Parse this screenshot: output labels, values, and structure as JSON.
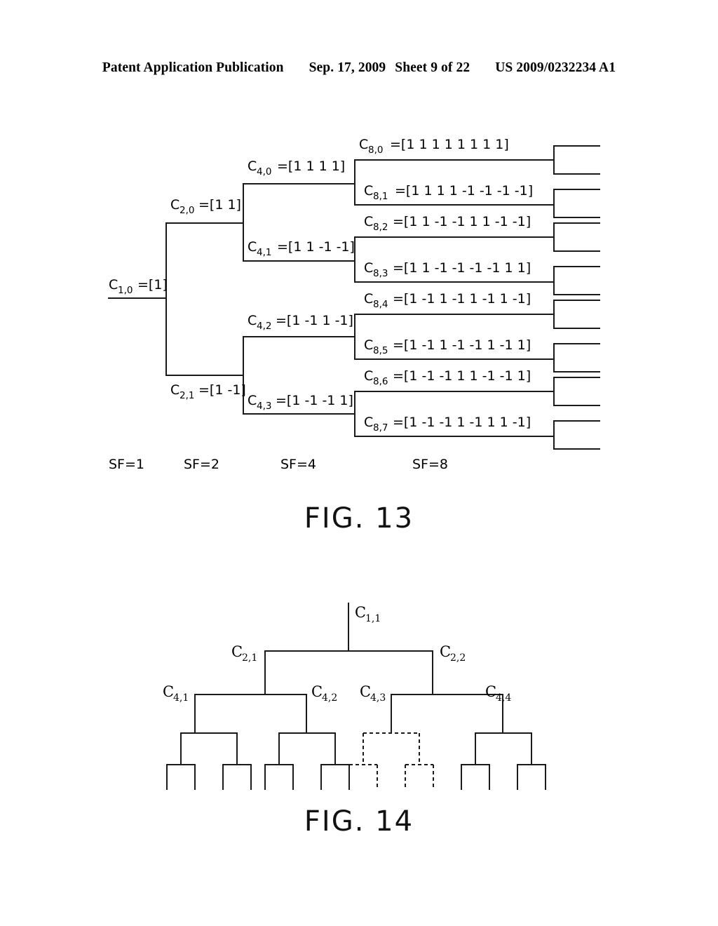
{
  "header": {
    "publication": "Patent Application Publication",
    "date": "Sep. 17, 2009",
    "sheet": "Sheet 9 of 22",
    "patent_number": "US 2009/0232234 A1"
  },
  "figure13": {
    "caption": "FIG. 13",
    "root": {
      "name": "C",
      "sub": "1,0",
      "value": "=[1]"
    },
    "level2": [
      {
        "name": "C",
        "sub": "2,0",
        "value": "=[1 1]"
      },
      {
        "name": "C",
        "sub": "2,1",
        "value": "=[1 -1]"
      }
    ],
    "level4": [
      {
        "name": "C",
        "sub": "4,0",
        "value": "=[1 1 1 1]"
      },
      {
        "name": "C",
        "sub": "4,1",
        "value": "=[1 1 -1 -1]"
      },
      {
        "name": "C",
        "sub": "4,2",
        "value": "=[1 -1 1 -1]"
      },
      {
        "name": "C",
        "sub": "4,3",
        "value": "=[1 -1 -1 1]"
      }
    ],
    "level8": [
      {
        "name": "C",
        "sub": "8,0",
        "value": "=[1 1 1 1 1 1 1 1]"
      },
      {
        "name": "C",
        "sub": "8,1",
        "value": "=[1 1 1 1 -1 -1 -1 -1]"
      },
      {
        "name": "C",
        "sub": "8,2",
        "value": "=[1 1 -1 -1 1 1 -1 -1]"
      },
      {
        "name": "C",
        "sub": "8,3",
        "value": "=[1 1 -1 -1 -1 -1 1 1]"
      },
      {
        "name": "C",
        "sub": "8,4",
        "value": "=[1 -1 1 -1 1 -1 1 -1]"
      },
      {
        "name": "C",
        "sub": "8,5",
        "value": "=[1 -1 1 -1 -1 1 -1 1]"
      },
      {
        "name": "C",
        "sub": "8,6",
        "value": "=[1 -1 -1 1 1 -1 -1 1]"
      },
      {
        "name": "C",
        "sub": "8,7",
        "value": "=[1 -1 -1 1 -1 1 1 -1]"
      }
    ],
    "spreading_factors": [
      {
        "label": "SF=1"
      },
      {
        "label": "SF=2"
      },
      {
        "label": "SF=4"
      },
      {
        "label": "SF=8"
      }
    ]
  },
  "figure14": {
    "caption": "FIG. 14",
    "nodes": [
      {
        "name": "C",
        "sub": "1,1"
      },
      {
        "name": "C",
        "sub": "2,1"
      },
      {
        "name": "C",
        "sub": "2,2"
      },
      {
        "name": "C",
        "sub": "4,1"
      },
      {
        "name": "C",
        "sub": "4,2"
      },
      {
        "name": "C",
        "sub": "4,3"
      },
      {
        "name": "C",
        "sub": "4,4"
      }
    ],
    "blocked_subtree": "C4,3"
  },
  "colors": {
    "ink": "#1a1a1a",
    "paper": "#ffffff"
  }
}
